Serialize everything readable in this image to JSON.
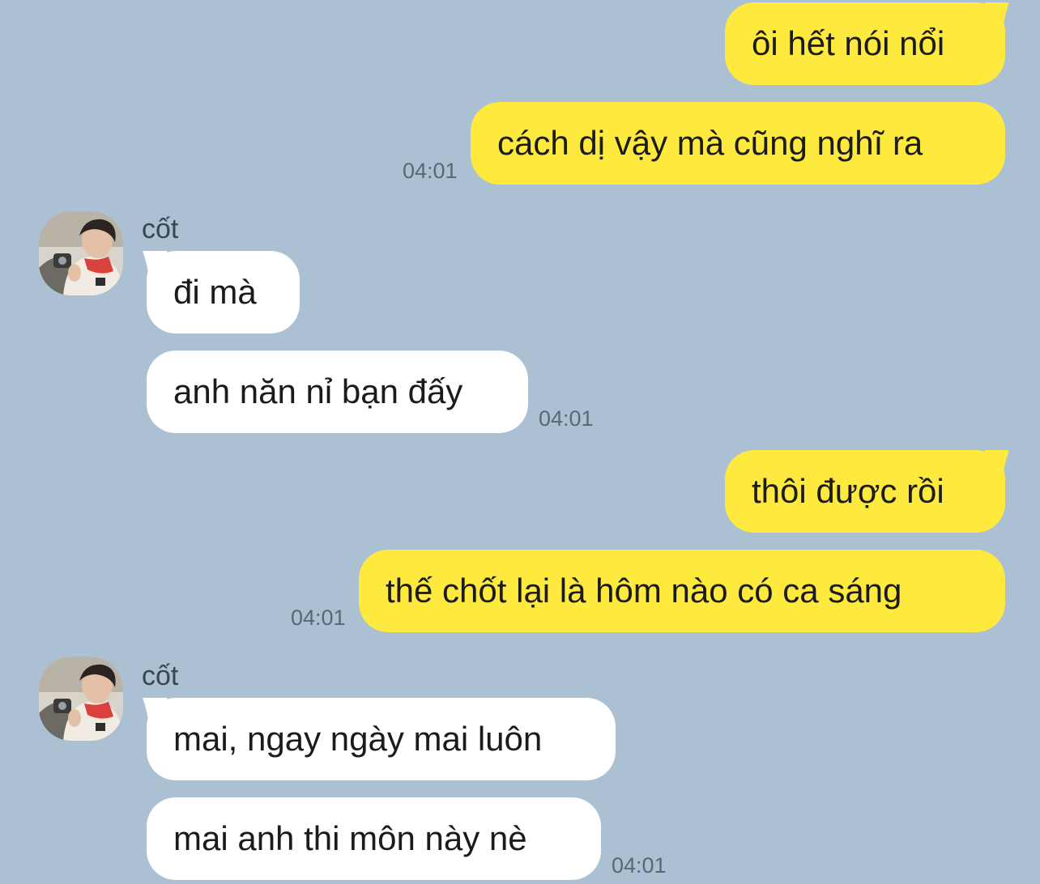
{
  "conversation": {
    "messages": [
      {
        "text": "ôi hết nói nổi",
        "direction": "outgoing"
      },
      {
        "text": "cách dị vậy mà cũng nghĩ ra",
        "direction": "outgoing",
        "time": "04:01"
      },
      {
        "sender": "cốt",
        "text": "đi mà",
        "direction": "incoming"
      },
      {
        "text": "anh năn nỉ bạn đấy",
        "direction": "incoming",
        "time": "04:01"
      },
      {
        "text": "thôi được rồi",
        "direction": "outgoing"
      },
      {
        "text": "thế chốt lại là hôm nào có ca sáng",
        "direction": "outgoing",
        "time": "04:01"
      },
      {
        "sender": "cốt",
        "text": "mai, ngay ngày mai luôn",
        "direction": "incoming"
      },
      {
        "text": "mai anh thi môn này nè",
        "direction": "incoming",
        "time": "04:01"
      }
    ]
  },
  "colors": {
    "background": "#abc1d3",
    "outgoing_bubble": "#fee93f",
    "incoming_bubble": "#ffffff",
    "timestamp": "#5b6773",
    "sender_name": "#3b4650"
  },
  "icons": {
    "avatar": "profile-photo-avatar"
  }
}
